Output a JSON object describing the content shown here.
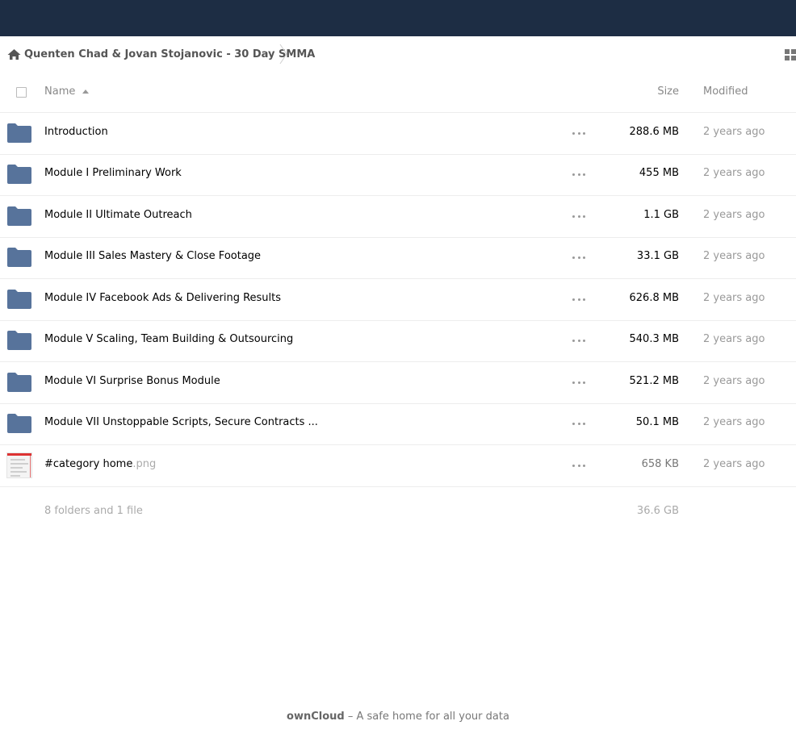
{
  "breadcrumb": {
    "home_icon": "home-icon",
    "folder": "Quenten Chad & Jovan Stojanovic - 30 Day SMMA"
  },
  "header": {
    "name": "Name",
    "size": "Size",
    "modified": "Modified"
  },
  "files": [
    {
      "name": "Introduction",
      "ext": "",
      "type": "folder",
      "size": "288.6 MB",
      "modified": "2 years ago"
    },
    {
      "name": "Module I Preliminary Work",
      "ext": "",
      "type": "folder",
      "size": "455 MB",
      "modified": "2 years ago"
    },
    {
      "name": "Module II Ultimate Outreach",
      "ext": "",
      "type": "folder",
      "size": "1.1 GB",
      "modified": "2 years ago"
    },
    {
      "name": "Module III Sales Mastery & Close Footage",
      "ext": "",
      "type": "folder",
      "size": "33.1 GB",
      "modified": "2 years ago"
    },
    {
      "name": "Module IV Facebook Ads & Delivering Results",
      "ext": "",
      "type": "folder",
      "size": "626.8 MB",
      "modified": "2 years ago"
    },
    {
      "name": "Module V Scaling, Team Building & Outsourcing",
      "ext": "",
      "type": "folder",
      "size": "540.3 MB",
      "modified": "2 years ago"
    },
    {
      "name": "Module VI Surprise Bonus Module",
      "ext": "",
      "type": "folder",
      "size": "521.2 MB",
      "modified": "2 years ago"
    },
    {
      "name": "Module VII Unstoppable Scripts, Secure Contracts ...",
      "ext": "",
      "type": "folder",
      "size": "50.1 MB",
      "modified": "2 years ago"
    },
    {
      "name": "#category home",
      "ext": ".png",
      "type": "image",
      "size": "658 KB",
      "modified": "2 years ago"
    }
  ],
  "summary": {
    "count": "8 folders and 1 file",
    "total_size": "36.6 GB"
  },
  "footer": {
    "brand": "ownCloud",
    "tagline": " – A safe home for all your data"
  },
  "colors": {
    "topbar": "#1d2d44",
    "folder": "#57739b"
  }
}
